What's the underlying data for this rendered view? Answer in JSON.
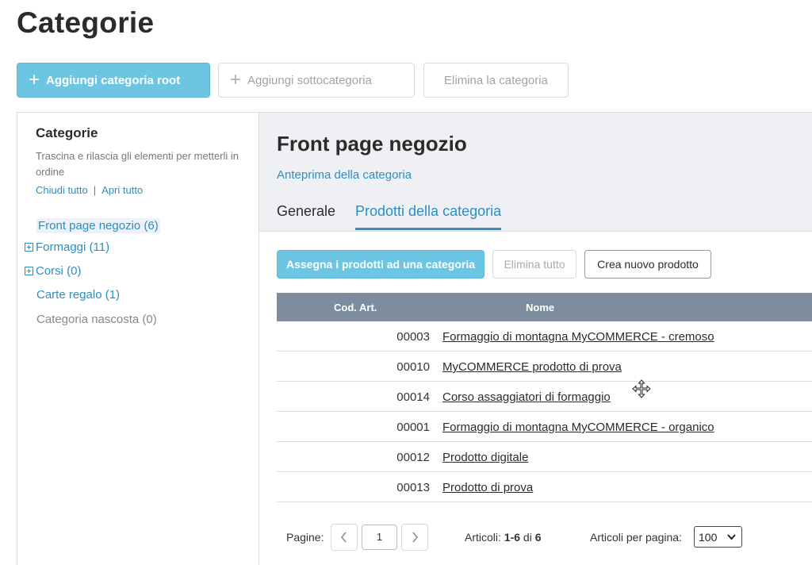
{
  "page_title": "Categorie",
  "toolbar": {
    "add_root_label": "Aggiungi categoria root",
    "add_sub_label": "Aggiungi sottocategoria",
    "delete_label": "Elimina la categoria"
  },
  "sidebar": {
    "title": "Categorie",
    "description": "Trascina e rilascia gli elementi per metterli in ordine",
    "collapse_all": "Chiudi tutto",
    "separator": "|",
    "expand_all": "Apri tutto",
    "items": [
      {
        "label": "Front page negozio (6)",
        "selected": true
      },
      {
        "label": "Formaggi (11)",
        "expandable": true
      },
      {
        "label": "Corsi (0)",
        "expandable": true
      },
      {
        "label": "Carte regalo (1)"
      },
      {
        "label": "Categoria nascosta (0)",
        "hidden": true
      }
    ]
  },
  "category": {
    "title": "Front page negozio",
    "preview_link": "Anteprima della categoria",
    "tabs": [
      {
        "label": "Generale",
        "active": false
      },
      {
        "label": "Prodotti della categoria",
        "active": true
      }
    ]
  },
  "actions": {
    "assign_label": "Assegna i prodotti ad una categoria",
    "delete_all_label": "Elimina tutto",
    "new_product_label": "Crea nuovo prodotto"
  },
  "table": {
    "columns": [
      "Cod. Art.",
      "Nome"
    ],
    "rows": [
      {
        "code": "00003",
        "name": "Formaggio di montagna MyCOMMERCE - cremoso"
      },
      {
        "code": "00010",
        "name": "MyCOMMERCE prodotto di prova"
      },
      {
        "code": "00014",
        "name": "Corso assaggiatori di formaggio"
      },
      {
        "code": "00001",
        "name": "Formaggio di montagna MyCOMMERCE - organico"
      },
      {
        "code": "00012",
        "name": "Prodotto digitale"
      },
      {
        "code": "00013",
        "name": "Prodotto di prova"
      }
    ]
  },
  "pagination": {
    "pages_label": "Pagine:",
    "current_page": "1",
    "articles_label": "Articoli:",
    "articles_range": "1-6",
    "articles_of": "di",
    "articles_total": "6",
    "per_page_label": "Articoli per pagina:",
    "per_page_value": "100"
  },
  "colors": {
    "accent": "#6cc5e3",
    "link": "#2d8ec4",
    "table_header": "#7d8d9e"
  }
}
